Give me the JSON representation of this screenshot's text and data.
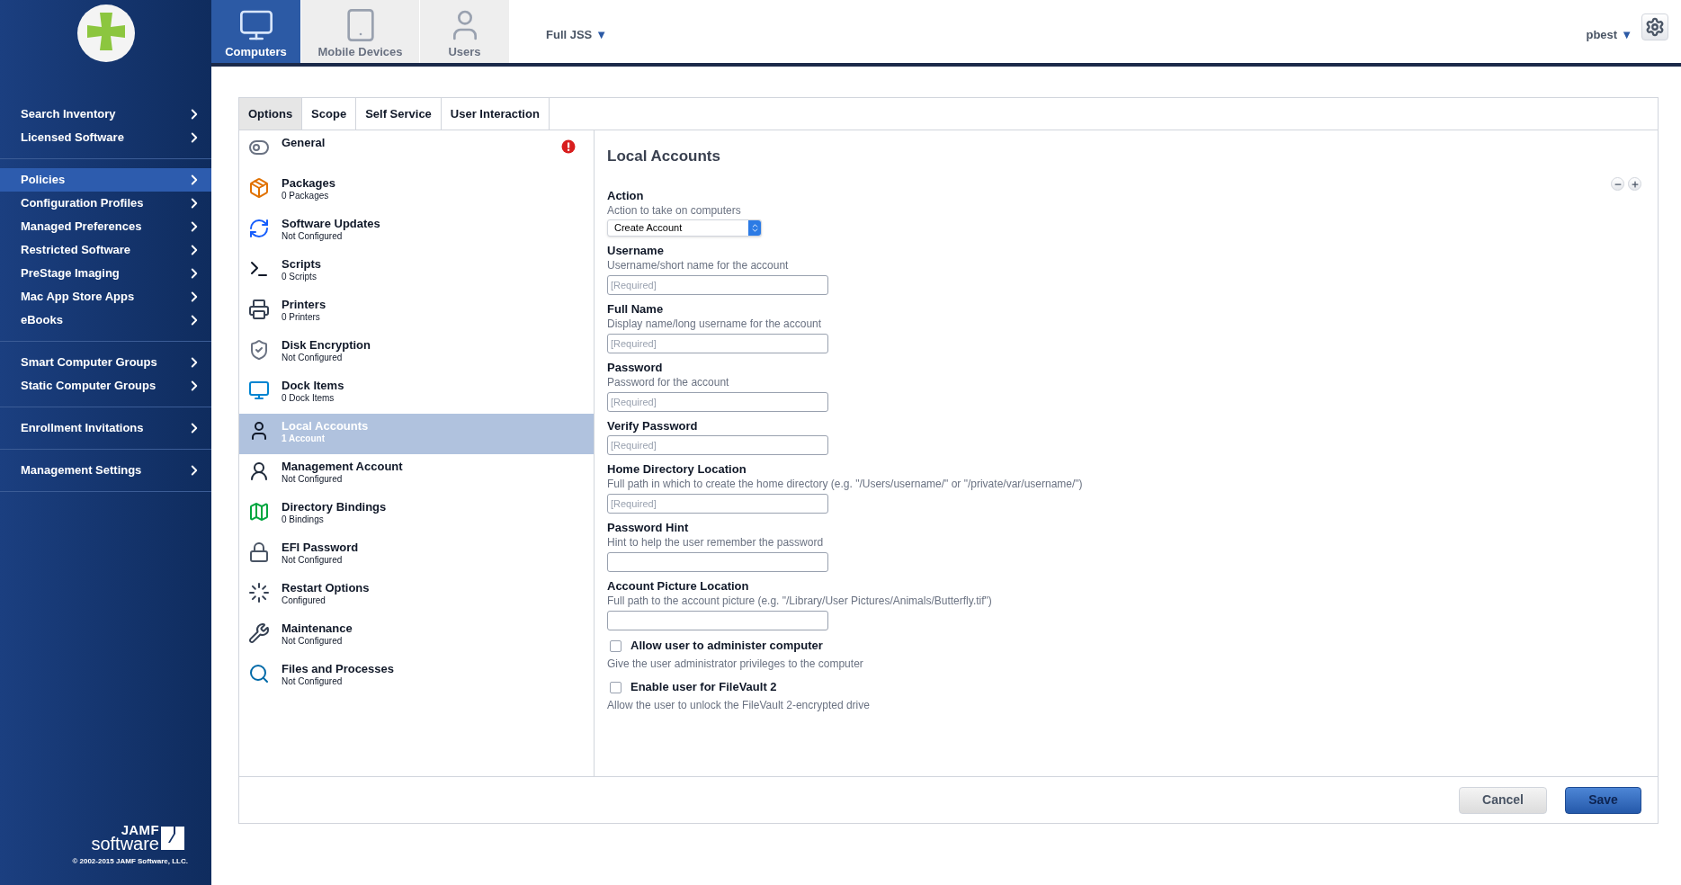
{
  "sidebar": {
    "copyright": "© 2002-2015 JAMF Software, LLC.",
    "brand_top": "JAMF",
    "brand_bottom": "software",
    "groups": [
      {
        "items": [
          {
            "label": "Search Inventory",
            "selected": false
          },
          {
            "label": "Licensed Software",
            "selected": false
          }
        ]
      },
      {
        "items": [
          {
            "label": "Policies",
            "selected": true
          },
          {
            "label": "Configuration Profiles",
            "selected": false
          },
          {
            "label": "Managed Preferences",
            "selected": false
          },
          {
            "label": "Restricted Software",
            "selected": false
          },
          {
            "label": "PreStage Imaging",
            "selected": false
          },
          {
            "label": "Mac App Store Apps",
            "selected": false
          },
          {
            "label": "eBooks",
            "selected": false
          }
        ]
      },
      {
        "items": [
          {
            "label": "Smart Computer Groups",
            "selected": false
          },
          {
            "label": "Static Computer Groups",
            "selected": false
          }
        ]
      },
      {
        "items": [
          {
            "label": "Enrollment Invitations",
            "selected": false
          }
        ]
      },
      {
        "items": [
          {
            "label": "Management Settings",
            "selected": false
          }
        ]
      }
    ]
  },
  "top_tabs": [
    {
      "label": "Computers",
      "selected": true
    },
    {
      "label": "Mobile Devices",
      "selected": false
    },
    {
      "label": "Users",
      "selected": false
    }
  ],
  "site_menu": "Full JSS",
  "site_caret": "▼",
  "user_menu": "pbest",
  "user_caret": "▼",
  "tabs": [
    {
      "label": "Options",
      "selected": true
    },
    {
      "label": "Scope",
      "selected": false
    },
    {
      "label": "Self Service",
      "selected": false
    },
    {
      "label": "User Interaction",
      "selected": false
    }
  ],
  "payloads": [
    {
      "title": "General",
      "alert": true,
      "selected": false
    },
    {
      "title": "Packages",
      "subtitle": "0 Packages",
      "alert": false,
      "selected": false
    },
    {
      "title": "Software Updates",
      "subtitle": "Not Configured",
      "alert": false,
      "selected": false
    },
    {
      "title": "Scripts",
      "subtitle": "0 Scripts",
      "alert": false,
      "selected": false
    },
    {
      "title": "Printers",
      "subtitle": "0 Printers",
      "alert": false,
      "selected": false
    },
    {
      "title": "Disk Encryption",
      "subtitle": "Not Configured",
      "alert": false,
      "selected": false
    },
    {
      "title": "Dock Items",
      "subtitle": "0 Dock Items",
      "alert": false,
      "selected": false
    },
    {
      "title": "Local Accounts",
      "subtitle": "1 Account",
      "alert": false,
      "selected": true
    },
    {
      "title": "Management Account",
      "subtitle": "Not Configured",
      "alert": false,
      "selected": false
    },
    {
      "title": "Directory Bindings",
      "subtitle": "0 Bindings",
      "alert": false,
      "selected": false
    },
    {
      "title": "EFI Password",
      "subtitle": "Not Configured",
      "alert": false,
      "selected": false
    },
    {
      "title": "Restart Options",
      "subtitle": "Configured",
      "alert": false,
      "selected": false
    },
    {
      "title": "Maintenance",
      "subtitle": "Not Configured",
      "alert": false,
      "selected": false
    },
    {
      "title": "Files and Processes",
      "subtitle": "Not Configured",
      "alert": false,
      "selected": false
    }
  ],
  "form": {
    "title": "Local Accounts",
    "fields": [
      {
        "kind": "select",
        "label": "Action",
        "hint": "Action to take on computers",
        "value": "Create Account"
      },
      {
        "kind": "text",
        "label": "Username",
        "hint": "Username/short name for the account",
        "placeholder": "[Required]"
      },
      {
        "kind": "text",
        "label": "Full Name",
        "hint": "Display name/long username for the account",
        "placeholder": "[Required]"
      },
      {
        "kind": "text",
        "label": "Password",
        "hint": "Password for the account",
        "placeholder": "[Required]"
      },
      {
        "kind": "text",
        "label": "Verify Password",
        "placeholder": "[Required]"
      },
      {
        "kind": "text",
        "label": "Home Directory Location",
        "hint": "Full path in which to create the home directory (e.g. \"/Users/username/\" or \"/private/var/username/\")",
        "placeholder": "[Required]"
      },
      {
        "kind": "text",
        "label": "Password Hint",
        "hint": "Hint to help the user remember the password"
      },
      {
        "kind": "text",
        "label": "Account Picture Location",
        "hint": "Full path to the account picture (e.g. \"/Library/User Pictures/Animals/Butterfly.tif\")"
      },
      {
        "kind": "checkbox",
        "label": "Allow user to administer computer",
        "hint": "Give the user administrator privileges to the computer",
        "checked": false
      },
      {
        "kind": "checkbox",
        "label": "Enable user for FileVault 2",
        "hint": "Allow the user to unlock the FileVault 2-encrypted drive",
        "checked": false
      }
    ]
  },
  "buttons": {
    "cancel": "Cancel",
    "save": "Save"
  }
}
